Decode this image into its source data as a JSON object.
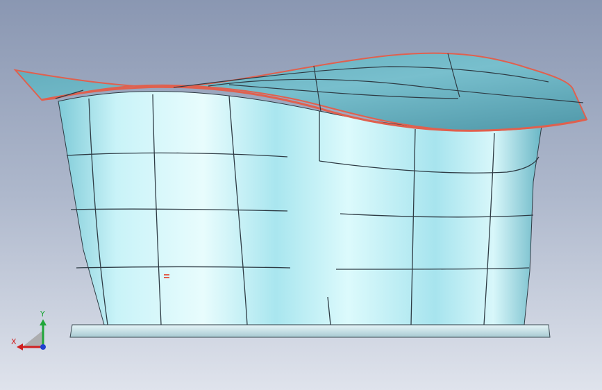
{
  "viewport": {
    "background_top": "#8a97b2",
    "background_bottom": "#dfe3ec"
  },
  "model": {
    "surface_color": "#9fe4ef",
    "roof_color": "#6fb9c8",
    "edge_color": "#e0604e",
    "line_color": "#2e3b44"
  },
  "triad": {
    "x_label": "X",
    "y_label": "Y",
    "x_color": "#d01f1f",
    "y_color": "#20a63a",
    "z_color": "#2040d0"
  }
}
